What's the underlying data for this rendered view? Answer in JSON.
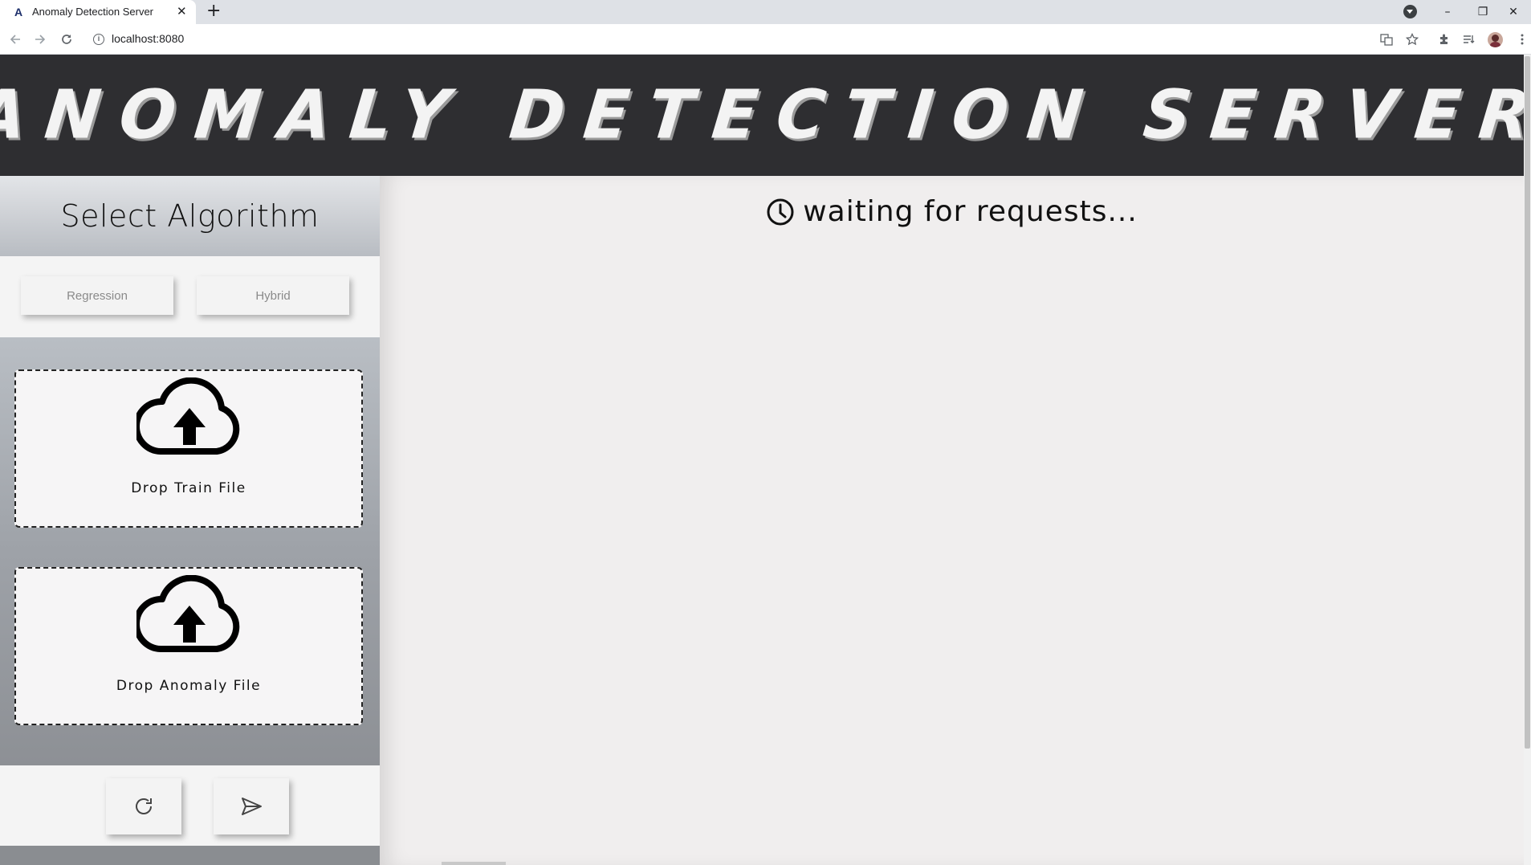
{
  "browser": {
    "tab_favicon": "A",
    "tab_title": "Anomaly Detection Server",
    "tab_close": "✕",
    "new_tab": "+",
    "url": "localhost:8080",
    "icons": [
      "back-arrow-icon",
      "forward-arrow-icon",
      "reload-icon",
      "info-icon",
      "translate-icon",
      "star-icon",
      "extensions-icon",
      "reading-list-icon",
      "profile-avatar",
      "more-menu-icon"
    ],
    "window_controls": {
      "minimize": "–",
      "restore": "❐",
      "close": "✕"
    }
  },
  "header": {
    "title": "ANOMALY DETECTION SERVER"
  },
  "sidebar": {
    "title": "Select Algorithm",
    "algorithms": [
      {
        "label": "Regression"
      },
      {
        "label": "Hybrid"
      }
    ],
    "dropzones": [
      {
        "label": "Drop Train File",
        "icon": "cloud-upload-icon"
      },
      {
        "label": "Drop Anomaly File",
        "icon": "cloud-upload-icon"
      }
    ],
    "actions": [
      {
        "name": "reset",
        "icon": "refresh-icon"
      },
      {
        "name": "send",
        "icon": "send-icon"
      }
    ]
  },
  "main": {
    "status_icon": "clock-icon",
    "status_text": "waiting for requests..."
  },
  "colors": {
    "header_bg": "#2e2e31",
    "header_text": "#f3f3f3",
    "page_bg": "#f0eeee",
    "sidebar_gradient_top": "#b9bec4",
    "sidebar_gradient_bottom": "#8d9095"
  }
}
